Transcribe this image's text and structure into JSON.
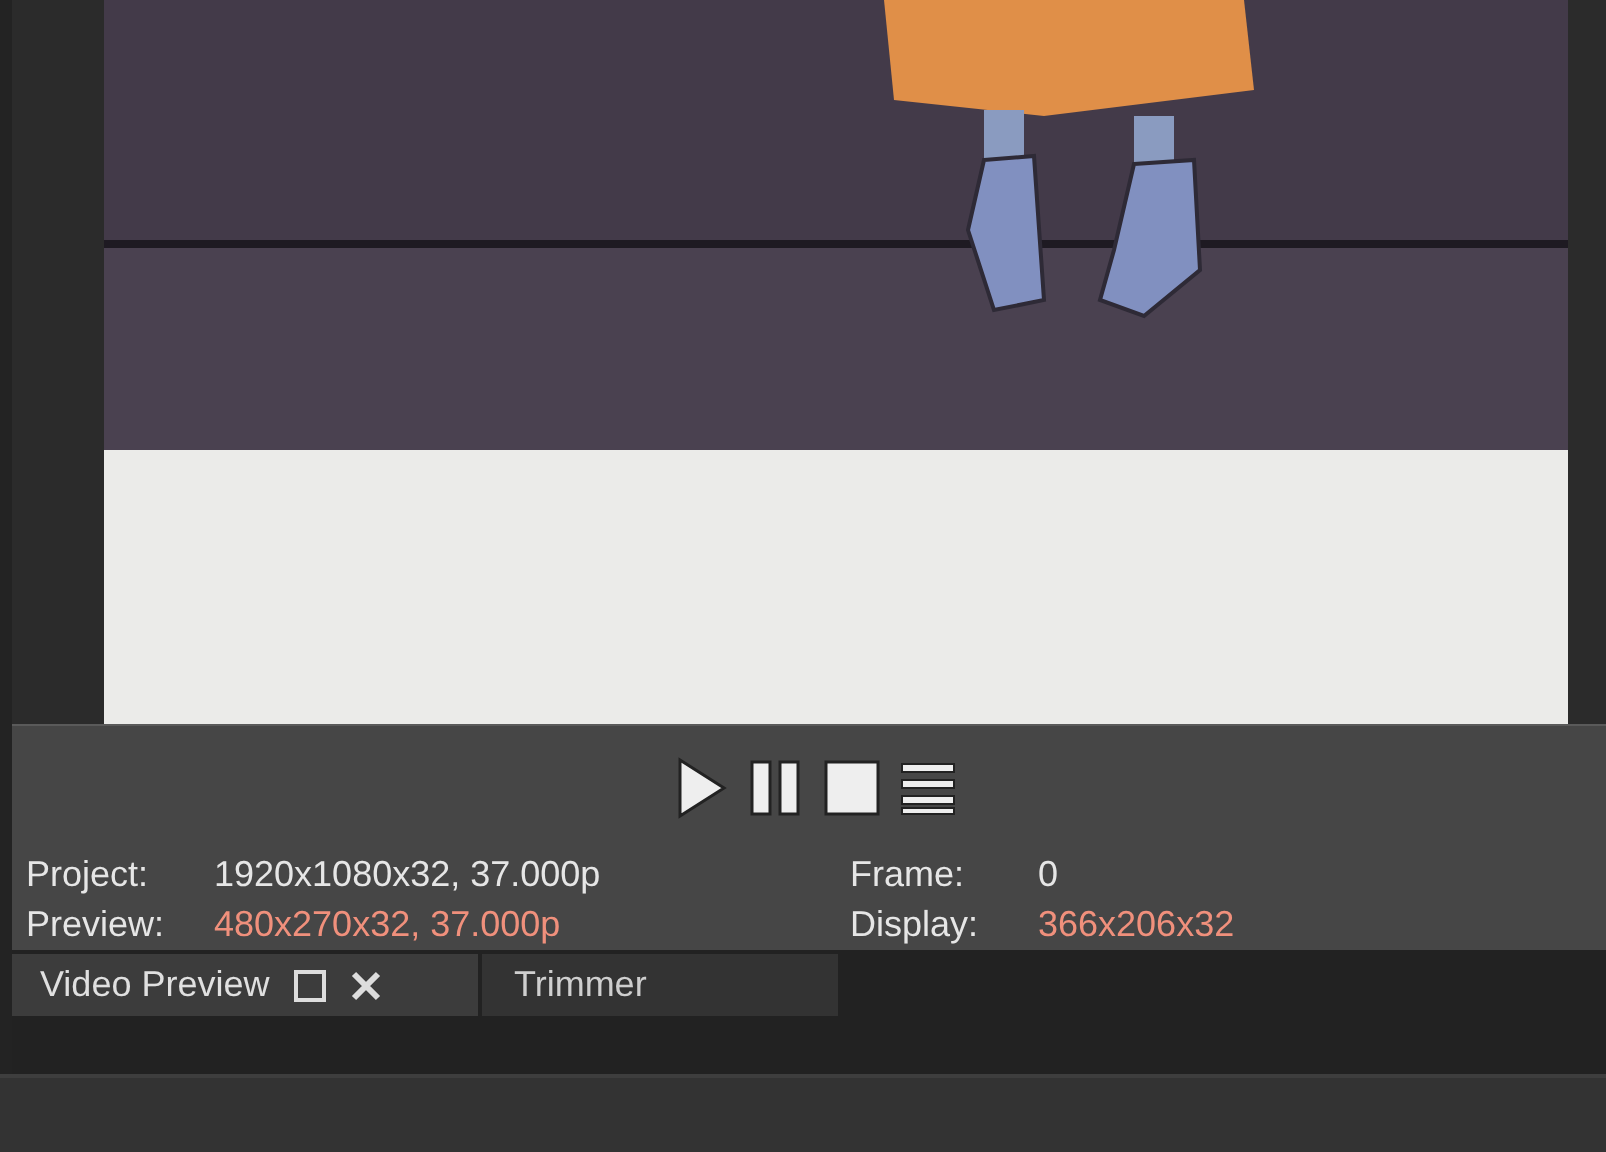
{
  "transport": [
    {
      "kind": "play"
    },
    {
      "kind": "pause"
    },
    {
      "kind": "stop"
    },
    {
      "kind": "menu"
    }
  ],
  "info": [
    {
      "label": "Project:",
      "value": "1920x1080x32, 37.000p",
      "highlight": false
    },
    {
      "label": "Frame:",
      "value": "0",
      "highlight": false
    },
    {
      "label": "Preview:",
      "value": "480x270x32, 37.000p",
      "highlight": true
    },
    {
      "label": "Display:",
      "value": "366x206x32",
      "highlight": true
    }
  ],
  "tabs": [
    {
      "label": "Video Preview",
      "selected": true
    },
    {
      "label": "Trimmer",
      "selected": false
    }
  ]
}
